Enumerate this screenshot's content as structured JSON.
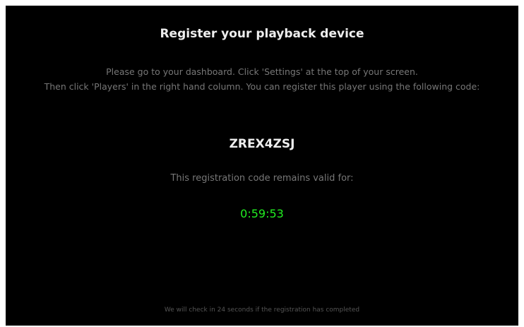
{
  "colors": {
    "background": "#000000",
    "heading": "#eeeeee",
    "text": "#777777",
    "countdown": "#22ee22",
    "footer": "#555555"
  },
  "page": {
    "title": "Register your playback device",
    "instructions": {
      "line1": "Please go to your dashboard. Click 'Settings' at the top of your screen.",
      "line2": "Then click 'Players' in the right hand column. You can register this player using the following code:"
    },
    "registration_code": "ZREX4ZSJ",
    "valid_label": "This registration code remains valid for:",
    "countdown": "0:59:53",
    "footer_status": "We will check in 24 seconds if the registration has completed"
  }
}
